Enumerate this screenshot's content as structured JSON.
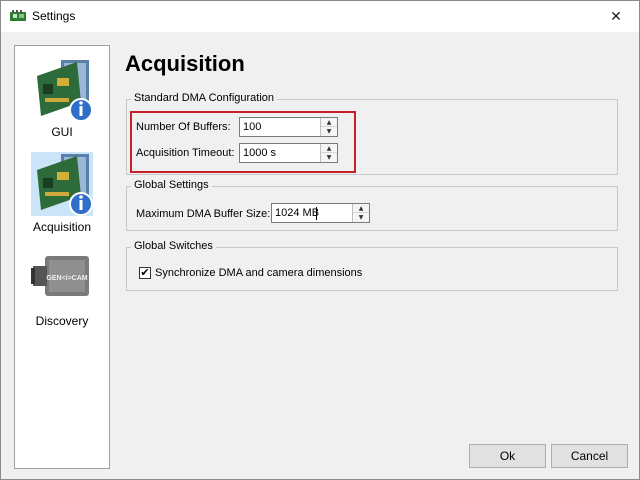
{
  "window": {
    "title": "Settings",
    "close_glyph": "✕"
  },
  "sidebar": {
    "items": [
      {
        "label": "GUI",
        "icon": "network-card-info-icon",
        "selected": false
      },
      {
        "label": "Acquisition",
        "icon": "network-card-info-icon",
        "selected": true
      },
      {
        "label": "Discovery",
        "icon": "genicam-camera-icon",
        "selected": false
      }
    ],
    "genicam_text": "GEN<i>CAM"
  },
  "page": {
    "title": "Acquisition"
  },
  "dma_config": {
    "title": "Standard DMA Configuration",
    "buffers_label": "Number Of Buffers:",
    "buffers_value": "100",
    "timeout_label": "Acquisition Timeout:",
    "timeout_value": "1000 s"
  },
  "global_settings": {
    "title": "Global Settings",
    "max_dma_label": "Maximum DMA Buffer Size:",
    "max_dma_value": "1024 MB"
  },
  "global_switches": {
    "title": "Global Switches",
    "sync_label": "Synchronize DMA and camera dimensions",
    "sync_checked": true,
    "check_glyph": "✔"
  },
  "footer": {
    "ok_label": "Ok",
    "cancel_label": "Cancel"
  },
  "colors": {
    "highlight": "#c4202a",
    "selection": "#cce4f7"
  },
  "spin_glyphs": {
    "up": "▲",
    "down": "▼"
  }
}
